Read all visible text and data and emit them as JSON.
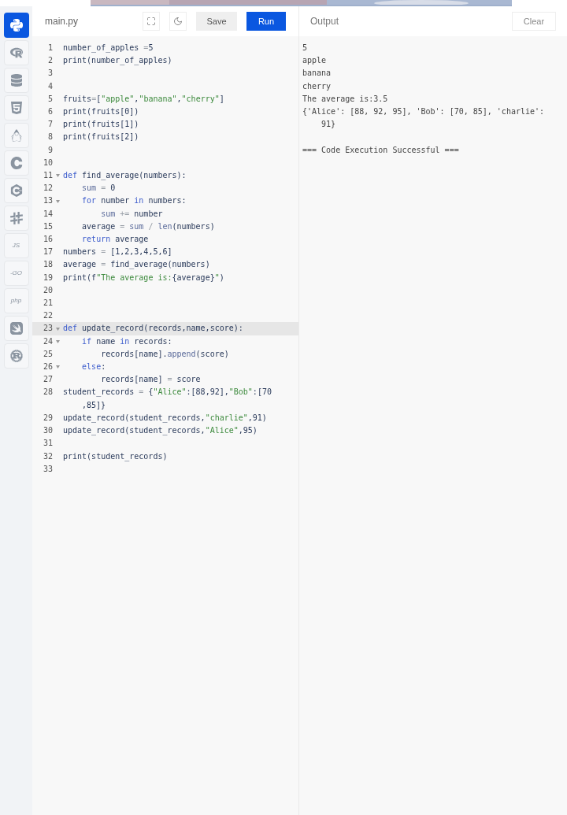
{
  "sidebar": {
    "items": [
      {
        "selected": true
      },
      {
        "selected": false
      },
      {
        "selected": false
      },
      {
        "selected": false
      },
      {
        "selected": false
      },
      {
        "selected": false
      },
      {
        "selected": false
      },
      {
        "selected": false
      },
      {
        "label": "JS",
        "selected": false
      },
      {
        "label": "-GO",
        "selected": false
      },
      {
        "label": "php",
        "selected": false
      },
      {
        "selected": false
      },
      {
        "selected": false
      }
    ]
  },
  "editor": {
    "filename": "main.py",
    "buttons": [
      "Save",
      "Run"
    ],
    "lines": [
      {
        "number": "1",
        "fold": false,
        "active": false,
        "tokens": [
          {
            "kind": "plain",
            "text": "number_of_apples "
          },
          {
            "kind": "operator",
            "text": "="
          },
          {
            "kind": "plain",
            "text": "5"
          }
        ]
      },
      {
        "number": "2",
        "fold": false,
        "active": false,
        "tokens": [
          {
            "kind": "plain",
            "text": "print(number_of_apples)"
          }
        ]
      },
      {
        "number": "3",
        "fold": false,
        "active": false
      },
      {
        "number": "4",
        "fold": false,
        "active": false
      },
      {
        "number": "5",
        "fold": false,
        "active": false,
        "tokens": [
          {
            "kind": "plain",
            "text": "fruits"
          },
          {
            "kind": "operator",
            "text": "="
          },
          {
            "kind": "plain",
            "text": "["
          },
          {
            "kind": "string",
            "text": "\"apple\""
          },
          {
            "kind": "plain",
            "text": ","
          },
          {
            "kind": "string",
            "text": "\"banana\""
          },
          {
            "kind": "plain",
            "text": ","
          },
          {
            "kind": "string",
            "text": "\"cherry\""
          },
          {
            "kind": "plain",
            "text": "]"
          }
        ]
      },
      {
        "number": "6",
        "fold": false,
        "active": false,
        "tokens": [
          {
            "kind": "plain",
            "text": "print(fruits[0])"
          }
        ]
      },
      {
        "number": "7",
        "fold": false,
        "active": false,
        "tokens": [
          {
            "kind": "plain",
            "text": "print(fruits[1])"
          }
        ]
      },
      {
        "number": "8",
        "fold": false,
        "active": false,
        "tokens": [
          {
            "kind": "plain",
            "text": "print(fruits[2])"
          }
        ]
      },
      {
        "number": "9",
        "fold": false,
        "active": false
      },
      {
        "number": "10",
        "fold": false,
        "active": false
      },
      {
        "number": "11",
        "fold": true,
        "active": false,
        "tokens": [
          {
            "kind": "keyword",
            "text": "def"
          },
          {
            "kind": "plain",
            "text": " find_average(numbers):"
          }
        ]
      },
      {
        "number": "12",
        "fold": false,
        "active": false,
        "tokens": [
          {
            "kind": "builtin",
            "text": "    sum"
          },
          {
            "kind": "operator",
            "text": " = "
          },
          {
            "kind": "plain",
            "text": "0"
          }
        ]
      },
      {
        "number": "13",
        "fold": true,
        "active": false,
        "tokens": [
          {
            "kind": "keyword",
            "text": "    for"
          },
          {
            "kind": "plain",
            "text": " number "
          },
          {
            "kind": "keyword",
            "text": "in"
          },
          {
            "kind": "plain",
            "text": " numbers:"
          }
        ]
      },
      {
        "number": "14",
        "fold": false,
        "active": false,
        "tokens": [
          {
            "kind": "builtin",
            "text": "        sum"
          },
          {
            "kind": "operator",
            "text": " += "
          },
          {
            "kind": "plain",
            "text": "number"
          }
        ]
      },
      {
        "number": "15",
        "fold": false,
        "active": false,
        "tokens": [
          {
            "kind": "plain",
            "text": "    average"
          },
          {
            "kind": "operator",
            "text": " = "
          },
          {
            "kind": "builtin",
            "text": "sum"
          },
          {
            "kind": "operator",
            "text": " / "
          },
          {
            "kind": "builtin",
            "text": "len"
          },
          {
            "kind": "plain",
            "text": "(numbers)"
          }
        ]
      },
      {
        "number": "16",
        "fold": false,
        "active": false,
        "tokens": [
          {
            "kind": "keyword",
            "text": "    return"
          },
          {
            "kind": "plain",
            "text": " average"
          }
        ]
      },
      {
        "number": "17",
        "fold": false,
        "active": false,
        "tokens": [
          {
            "kind": "plain",
            "text": "numbers"
          },
          {
            "kind": "operator",
            "text": " = "
          },
          {
            "kind": "plain",
            "text": "[1,2,3,4,5,6]"
          }
        ]
      },
      {
        "number": "18",
        "fold": false,
        "active": false,
        "tokens": [
          {
            "kind": "plain",
            "text": "average"
          },
          {
            "kind": "operator",
            "text": " = "
          },
          {
            "kind": "plain",
            "text": "find_average(numbers)"
          }
        ]
      },
      {
        "number": "19",
        "fold": false,
        "active": false,
        "tokens": [
          {
            "kind": "plain",
            "text": "print(f"
          },
          {
            "kind": "string",
            "text": "\"The average is:"
          },
          {
            "kind": "plain",
            "text": "{average}"
          },
          {
            "kind": "string",
            "text": "\""
          },
          {
            "kind": "plain",
            "text": ")"
          }
        ]
      },
      {
        "number": "20",
        "fold": false,
        "active": false
      },
      {
        "number": "21",
        "fold": false,
        "active": false
      },
      {
        "number": "22",
        "fold": false,
        "active": false
      },
      {
        "number": "23",
        "fold": true,
        "active": true,
        "tokens": [
          {
            "kind": "keyword",
            "text": "def"
          },
          {
            "kind": "plain",
            "text": " update_record(records,name,score):"
          }
        ]
      },
      {
        "number": "24",
        "fold": true,
        "active": false,
        "tokens": [
          {
            "kind": "keyword",
            "text": "    if"
          },
          {
            "kind": "plain",
            "text": " name "
          },
          {
            "kind": "keyword",
            "text": "in"
          },
          {
            "kind": "plain",
            "text": " records:"
          }
        ]
      },
      {
        "number": "25",
        "fold": false,
        "active": false,
        "tokens": [
          {
            "kind": "plain",
            "text": "        records[name]."
          },
          {
            "kind": "builtin",
            "text": "append"
          },
          {
            "kind": "plain",
            "text": "(score)"
          }
        ]
      },
      {
        "number": "26",
        "fold": true,
        "active": false,
        "tokens": [
          {
            "kind": "keyword",
            "text": "    else"
          },
          {
            "kind": "plain",
            "text": ":"
          }
        ]
      },
      {
        "number": "27",
        "fold": false,
        "active": false,
        "tokens": [
          {
            "kind": "plain",
            "text": "        records[name]"
          },
          {
            "kind": "operator",
            "text": " = "
          },
          {
            "kind": "plain",
            "text": "score"
          }
        ]
      },
      {
        "number": "28",
        "fold": false,
        "active": false,
        "tokens": [
          {
            "kind": "plain",
            "text": "student_records"
          },
          {
            "kind": "operator",
            "text": " = "
          },
          {
            "kind": "plain",
            "text": "{"
          },
          {
            "kind": "string",
            "text": "\"Alice\""
          },
          {
            "kind": "plain",
            "text": ":[88,92],"
          },
          {
            "kind": "string",
            "text": "\"Bob\""
          },
          {
            "kind": "plain",
            "text": ":[70"
          }
        ],
        "continuation": [
          {
            "kind": "plain",
            "text": ",85]}"
          }
        ]
      },
      {
        "number": "29",
        "fold": false,
        "active": false,
        "tokens": [
          {
            "kind": "plain",
            "text": "update_record(student_records,"
          },
          {
            "kind": "string",
            "text": "\"charlie\""
          },
          {
            "kind": "plain",
            "text": ",91)"
          }
        ]
      },
      {
        "number": "30",
        "fold": false,
        "active": false,
        "tokens": [
          {
            "kind": "plain",
            "text": "update_record(student_records,"
          },
          {
            "kind": "string",
            "text": "\"Alice\""
          },
          {
            "kind": "plain",
            "text": ",95)"
          }
        ]
      },
      {
        "number": "31",
        "fold": false,
        "active": false
      },
      {
        "number": "32",
        "fold": false,
        "active": false,
        "tokens": [
          {
            "kind": "plain",
            "text": "print(student_records)"
          }
        ]
      },
      {
        "number": "33",
        "fold": false,
        "active": false
      }
    ]
  },
  "output": {
    "title": "Output",
    "clear": "Clear",
    "lines": [
      "5",
      "apple",
      "banana",
      "cherry",
      "The average is:3.5",
      "{'Alice': [88, 92, 95], 'Bob': [70, 85], 'charlie':",
      "    91}"
    ],
    "status": "=== Code Execution Successful ==="
  }
}
